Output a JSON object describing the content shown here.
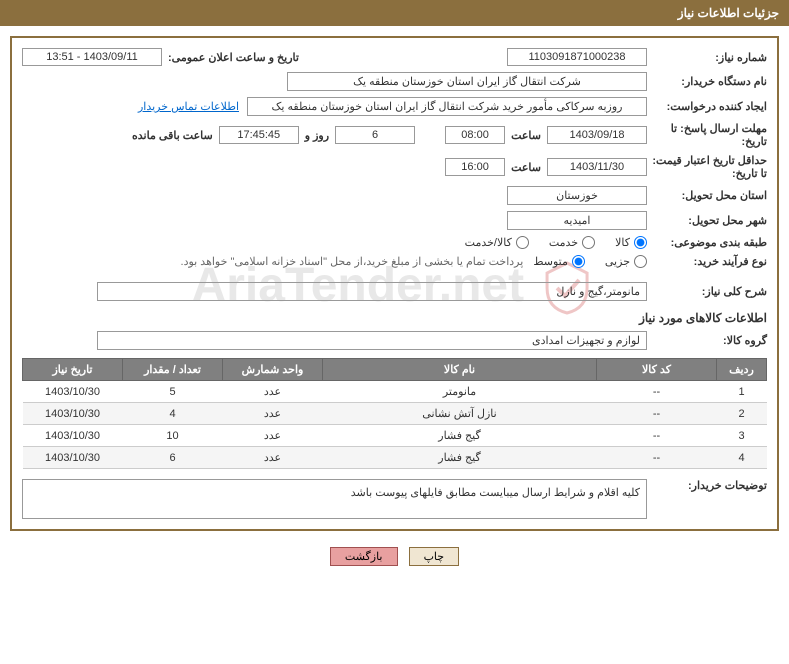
{
  "header_title": "جزئیات اطلاعات نیاز",
  "fields": {
    "need_number_label": "شماره نیاز:",
    "need_number": "1103091871000238",
    "announce_label": "تاریخ و ساعت اعلان عمومی:",
    "announce_value": "1403/09/11 - 13:51",
    "buyer_org_label": "نام دستگاه خریدار:",
    "buyer_org": "شرکت انتقال گاز ایران  استان خوزستان منطقه یک",
    "requester_label": "ایجاد کننده درخواست:",
    "requester": "روزبه سرکاکی مأمور خرید شرکت انتقال گاز ایران  استان خوزستان منطقه یک",
    "contact_link": "اطلاعات تماس خریدار",
    "deadline_label": "مهلت ارسال پاسخ: تا تاریخ:",
    "deadline_date": "1403/09/18",
    "time_label": "ساعت",
    "deadline_time": "08:00",
    "days_value": "6",
    "days_and": "روز و",
    "countdown": "17:45:45",
    "remaining": "ساعت باقی مانده",
    "validity_label": "حداقل تاریخ اعتبار قیمت: تا تاریخ:",
    "validity_date": "1403/11/30",
    "validity_time": "16:00",
    "delivery_province_label": "استان محل تحویل:",
    "delivery_province": "خوزستان",
    "delivery_city_label": "شهر محل تحویل:",
    "delivery_city": "امیدیه",
    "category_label": "طبقه بندی موضوعی:",
    "cat_goods": "کالا",
    "cat_service": "خدمت",
    "cat_goods_service": "کالا/خدمت",
    "process_label": "نوع فرآیند خرید:",
    "proc_partial": "جزیی",
    "proc_medium": "متوسط",
    "process_note": "پرداخت تمام یا بخشی از مبلغ خرید،از محل \"اسناد خزانه اسلامی\" خواهد بود.",
    "need_desc_label": "شرح کلی نیاز:",
    "need_desc": "مانومتر،گیج و نازل",
    "items_section": "اطلاعات کالاهای مورد نیاز",
    "group_label": "گروه کالا:",
    "group_value": "لوازم و تجهیزات امدادی",
    "buyer_notes_label": "توضیحات خریدار:",
    "buyer_notes": "کلیه اقلام و شرایط ارسال میبایست مطابق فایلهای پیوست باشد"
  },
  "table": {
    "headers": {
      "row": "ردیف",
      "code": "کد کالا",
      "name": "نام کالا",
      "unit": "واحد شمارش",
      "qty": "تعداد / مقدار",
      "date": "تاریخ نیاز"
    },
    "rows": [
      {
        "row": "1",
        "code": "--",
        "name": "مانومتر",
        "unit": "عدد",
        "qty": "5",
        "date": "1403/10/30"
      },
      {
        "row": "2",
        "code": "--",
        "name": "نازل آتش نشانی",
        "unit": "عدد",
        "qty": "4",
        "date": "1403/10/30"
      },
      {
        "row": "3",
        "code": "--",
        "name": "گیج فشار",
        "unit": "عدد",
        "qty": "10",
        "date": "1403/10/30"
      },
      {
        "row": "4",
        "code": "--",
        "name": "گیج فشار",
        "unit": "عدد",
        "qty": "6",
        "date": "1403/10/30"
      }
    ]
  },
  "buttons": {
    "print": "چاپ",
    "back": "بازگشت"
  },
  "watermark_text": "AriaTender.net"
}
